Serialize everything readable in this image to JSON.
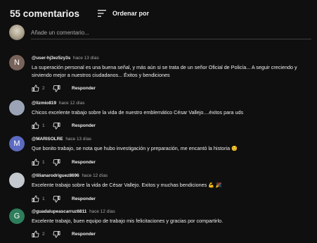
{
  "header": {
    "count": "55 comentarios",
    "sort_label": "Ordenar por"
  },
  "add_comment": {
    "placeholder": "Añade un comentario..."
  },
  "colors": {
    "bg": "#0f0f0f",
    "text": "#f1f1f1",
    "muted": "#aaaaaa",
    "divider": "#3f3f3f"
  },
  "reply_label": "Responder",
  "comments": [
    {
      "handle": "@user-hj3ez5zy3s",
      "time": "hace 13 días",
      "avatar_letter": "N",
      "avatar_color": "#78635a",
      "text": "La superación personal es una buena señal, y más aún si se trata de un señor Oficial de Policía... A seguir creciendo y sirviendo mejor a nuestros ciudadanos... Éxitos y bendiciones",
      "likes": "2"
    },
    {
      "handle": "@lizmio819",
      "time": "hace 12 días",
      "avatar_letter": "",
      "avatar_color": "#9aa4b6",
      "text": "Chicos excelente trabajo sobre la  vida de nuestro emblemático César Vallejo....éxitos para uds",
      "likes": "1"
    },
    {
      "handle": "@MARISOLRE",
      "time": "hace 13 días",
      "avatar_letter": "M",
      "avatar_color": "#5c6bc0",
      "text": "Que bonito trabajo, se nota que hubo investigación y preparación, me encantó la historia",
      "emoji": "😊",
      "likes": "1"
    },
    {
      "handle": "@lilianarodriguez8696",
      "time": "hace 12 días",
      "avatar_letter": "",
      "avatar_color": "#c4c9cf",
      "text": "Excelente trabajo sobre la vida de César Vallejo. Exitos y muchas bendiciones",
      "emoji": "💪 🎉",
      "likes": "1"
    },
    {
      "handle": "@guadalupeascarruz6811",
      "time": "hace 12 días",
      "avatar_letter": "G",
      "avatar_color": "#2e7d5b",
      "text": "Excelente trabajo, buen equipo de trabajo mis felicitaciones y gracias por compartirlo.",
      "likes": "2"
    }
  ]
}
